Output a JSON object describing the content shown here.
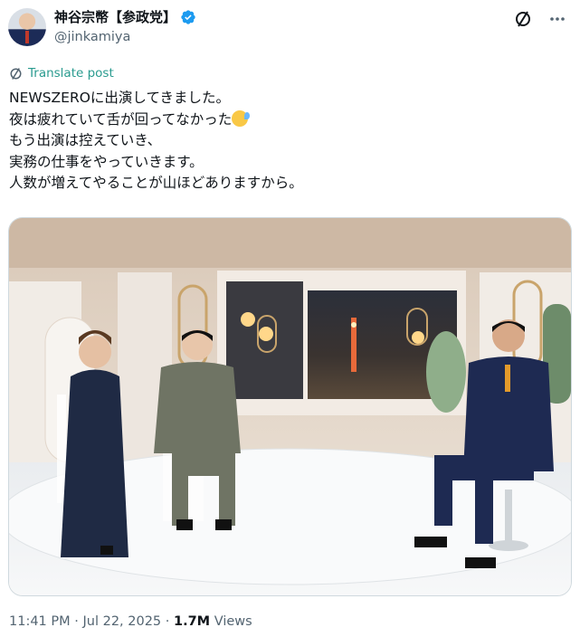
{
  "author": {
    "display_name": "神谷宗幣【参政党】",
    "handle": "@jinkamiya",
    "verified": true,
    "avatar_icon": "profile-photo"
  },
  "actions": {
    "grok_icon": "slash-circle-icon",
    "more_icon": "more-dots-icon"
  },
  "translate_label": "Translate post",
  "post_lines": [
    "NEWSZEROに出演してきました。",
    "夜は疲れていて舌が回ってなかった",
    "もう出演は控えていき、",
    "実務の仕事をやっていきます。",
    "人数が増えてやることが山ほどありますから。"
  ],
  "meta": {
    "time": "11:41 PM",
    "date": "Jul 22, 2025",
    "views_count": "1.7M",
    "views_label": "Views",
    "sep": "·"
  },
  "colors": {
    "accent": "#1d9bf0",
    "text": "#0f1419",
    "muted": "#536471"
  }
}
